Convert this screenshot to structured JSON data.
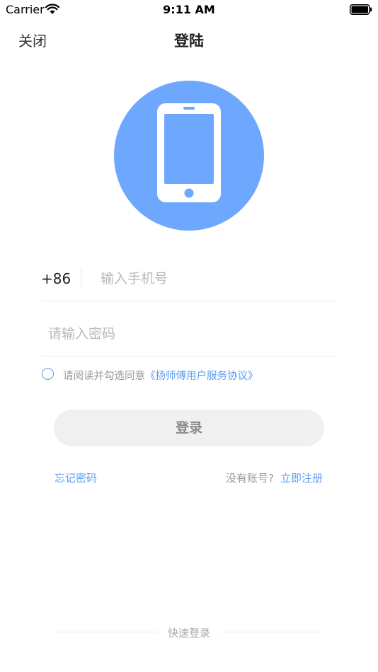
{
  "status_bar": {
    "carrier": "Carrier",
    "time": "9:11 AM"
  },
  "nav": {
    "close_label": "关闭",
    "title": "登陆"
  },
  "logo": {
    "icon": "phone-icon",
    "circle_color": "#6ea8fe"
  },
  "form": {
    "country_code": "+86",
    "phone_placeholder": "输入手机号",
    "phone_value": "",
    "password_placeholder": "请输入密码",
    "password_value": ""
  },
  "agreement": {
    "checked": false,
    "prefix": "请阅读并勾选同意",
    "link": "《扬师傅用户服务协议》"
  },
  "login_button": "登录",
  "links": {
    "forgot_password": "忘记密码",
    "no_account": "没有账号?",
    "register": "立即注册"
  },
  "quick_login": "快速登录",
  "colors": {
    "accent": "#5a9cf2",
    "button_bg": "#f0f0f0"
  }
}
